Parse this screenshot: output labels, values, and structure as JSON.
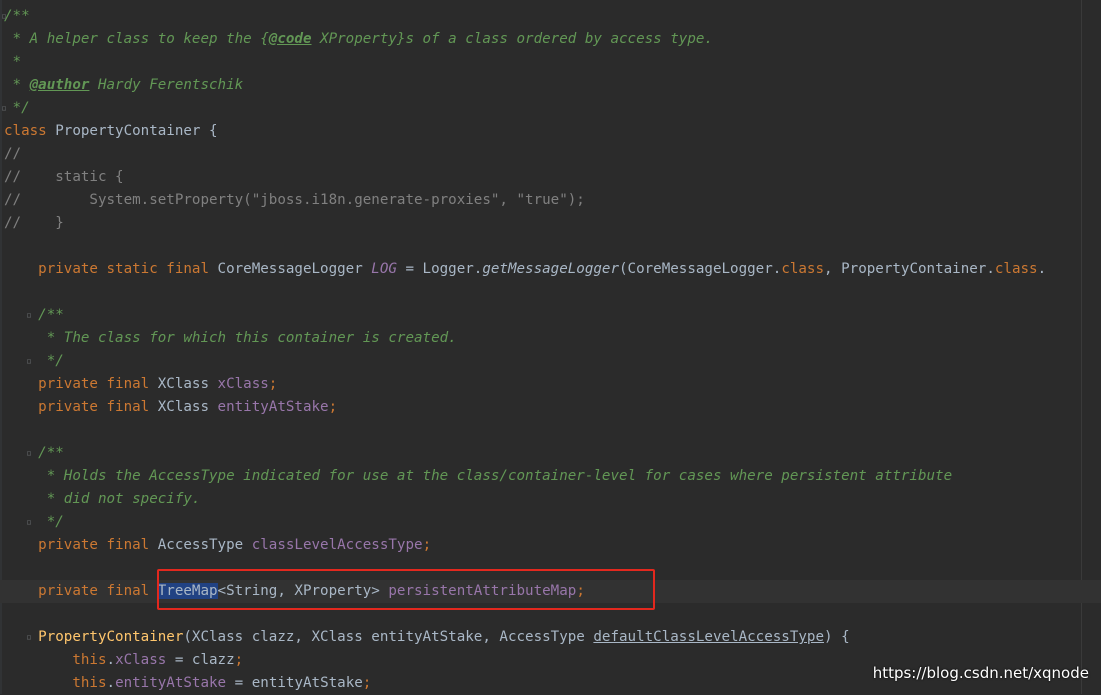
{
  "code_lines": [
    [
      {
        "t": "/**",
        "c": "cmt-doc"
      }
    ],
    [
      {
        "t": " * A helper class to keep the {",
        "c": "cmt-doc"
      },
      {
        "t": "@code",
        "c": "tag"
      },
      {
        "t": " XProperty}s of a class ordered by access type.",
        "c": "cmt-doc"
      }
    ],
    [
      {
        "t": " *",
        "c": "cmt-doc"
      }
    ],
    [
      {
        "t": " * ",
        "c": "cmt-doc"
      },
      {
        "t": "@author",
        "c": "tag"
      },
      {
        "t": " Hardy Ferentschik",
        "c": "cmt-doc"
      }
    ],
    [
      {
        "t": " */",
        "c": "cmt-doc"
      }
    ],
    [
      {
        "t": "class ",
        "c": "kw"
      },
      {
        "t": "PropertyContainer {",
        "c": "plain"
      }
    ],
    [
      {
        "t": "//",
        "c": "cmt"
      }
    ],
    [
      {
        "t": "//    static {",
        "c": "cmt"
      }
    ],
    [
      {
        "t": "//        System.setProperty(\"jboss.i18n.generate-proxies\", \"true\");",
        "c": "cmt"
      }
    ],
    [
      {
        "t": "//    }",
        "c": "cmt"
      }
    ],
    [],
    [
      {
        "t": "    private static final ",
        "c": "kw"
      },
      {
        "t": "CoreMessageLogger ",
        "c": "plain"
      },
      {
        "t": "LOG",
        "c": "fld-it"
      },
      {
        "t": " = Logger.",
        "c": "plain"
      },
      {
        "t": "getMessageLogger",
        "c": "meth-it"
      },
      {
        "t": "(CoreMessageLogger.",
        "c": "plain"
      },
      {
        "t": "class",
        "c": "kw"
      },
      {
        "t": ", PropertyContainer.",
        "c": "plain"
      },
      {
        "t": "class",
        "c": "kw"
      },
      {
        "t": ".",
        "c": "plain"
      }
    ],
    [],
    [
      {
        "t": "    /**",
        "c": "cmt-doc"
      }
    ],
    [
      {
        "t": "     * The class for which this container is created.",
        "c": "cmt-doc"
      }
    ],
    [
      {
        "t": "     */",
        "c": "cmt-doc"
      }
    ],
    [
      {
        "t": "    private final ",
        "c": "kw"
      },
      {
        "t": "XClass ",
        "c": "plain"
      },
      {
        "t": "xClass",
        "c": "fld"
      },
      {
        "t": ";",
        "c": "kw"
      }
    ],
    [
      {
        "t": "    private final ",
        "c": "kw"
      },
      {
        "t": "XClass ",
        "c": "plain"
      },
      {
        "t": "entityAtStake",
        "c": "fld"
      },
      {
        "t": ";",
        "c": "kw"
      }
    ],
    [],
    [
      {
        "t": "    /**",
        "c": "cmt-doc"
      }
    ],
    [
      {
        "t": "     * Holds the AccessType indicated for use at the class/container-level for cases where persistent attribute",
        "c": "cmt-doc"
      }
    ],
    [
      {
        "t": "     * did not specify.",
        "c": "cmt-doc"
      }
    ],
    [
      {
        "t": "     */",
        "c": "cmt-doc"
      }
    ],
    [
      {
        "t": "    private final ",
        "c": "kw"
      },
      {
        "t": "AccessType ",
        "c": "plain"
      },
      {
        "t": "classLevelAccessType",
        "c": "fld"
      },
      {
        "t": ";",
        "c": "kw"
      }
    ],
    [],
    [
      {
        "t": "    private final ",
        "c": "kw"
      },
      {
        "t": "TreeMap",
        "c": "sel plain"
      },
      {
        "t": "<String, XProperty> ",
        "c": "plain"
      },
      {
        "t": "persistentAttributeMap",
        "c": "fld"
      },
      {
        "t": ";",
        "c": "kw"
      }
    ],
    [],
    [
      {
        "t": "    ",
        "c": "plain"
      },
      {
        "t": "PropertyContainer",
        "c": "meth"
      },
      {
        "t": "(XClass clazz, XClass entityAtStake, AccessType ",
        "c": "plain"
      },
      {
        "t": "defaultClassLevelAccessType",
        "c": "param-u"
      },
      {
        "t": ") {",
        "c": "plain"
      }
    ],
    [
      {
        "t": "        ",
        "c": "plain"
      },
      {
        "t": "this",
        "c": "kw"
      },
      {
        "t": ".",
        "c": "plain"
      },
      {
        "t": "xClass",
        "c": "fld"
      },
      {
        "t": " = clazz",
        "c": "plain"
      },
      {
        "t": ";",
        "c": "kw"
      }
    ],
    [
      {
        "t": "        ",
        "c": "plain"
      },
      {
        "t": "this",
        "c": "kw"
      },
      {
        "t": ".",
        "c": "plain"
      },
      {
        "t": "entityAtStake",
        "c": "fld"
      },
      {
        "t": " = entityAtStake",
        "c": "plain"
      },
      {
        "t": ";",
        "c": "kw"
      }
    ]
  ],
  "current_line_index": 25,
  "watermark": "https://blog.csdn.net/xqnode",
  "colors": {
    "background": "#2b2b2b",
    "highlight_box": "#e2281e",
    "selection": "#214283"
  }
}
